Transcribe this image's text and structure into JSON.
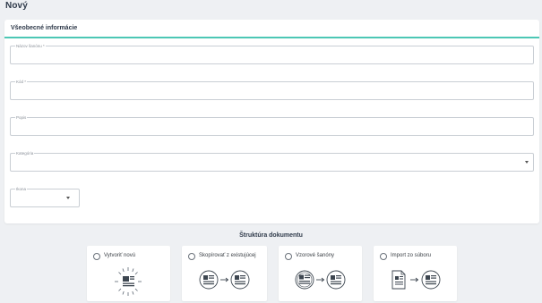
{
  "page": {
    "title": "Nový"
  },
  "general": {
    "section_title": "Všeobecné informácie",
    "fields": {
      "name_label": "Názov šanónu *",
      "code_label": "Kód *",
      "description_label": "Popis",
      "category_label": "Kategória",
      "icon_label": "Ikona"
    }
  },
  "structure": {
    "title": "Štruktúra dokumentu",
    "options": [
      {
        "label": "Vytvoriť novú",
        "icon": "new-document-burst-icon"
      },
      {
        "label": "Skopírovať z existujúcej",
        "icon": "copy-document-icon"
      },
      {
        "label": "Vzorové šanóny",
        "icon": "template-binders-icon"
      },
      {
        "label": "Import zo súboru",
        "icon": "import-file-icon"
      }
    ]
  },
  "colors": {
    "accent": "#4cc7b5",
    "text": "#2f3a4a",
    "border": "#c9ced4"
  }
}
